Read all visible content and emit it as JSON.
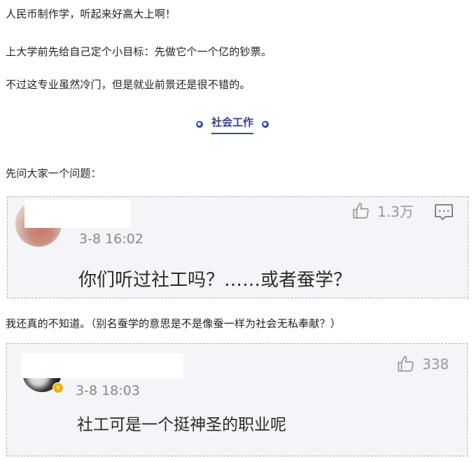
{
  "article": {
    "p1": "人民币制作学，听起来好高大上啊！",
    "p2": "上大学前先给自己定个小目标：先做它个一个亿的钞票。",
    "p3": "不过这专业虽然冷门，但是就业前景还是很不错的。",
    "section_title": "社会工作",
    "p4": "先问大家一个问题：",
    "p5": "我还真的不知道。（别名蚕学的意思是不是像蚕一样为社会无私奉献？）"
  },
  "comments": [
    {
      "time": "3-8 16:02",
      "likes": "1.3万",
      "text": "你们听过社工吗？……或者蚕学？"
    },
    {
      "time": "3-8 18:03",
      "likes": "338",
      "text": "社工可是一个挺神圣的职业呢"
    }
  ],
  "icons": {
    "like": "thumbs-up-icon",
    "comment": "comment-icon",
    "verified": "verified-badge-icon"
  },
  "colors": {
    "accent": "#2f3f8f",
    "card_bg": "#f4f4f9",
    "muted": "#888888"
  }
}
